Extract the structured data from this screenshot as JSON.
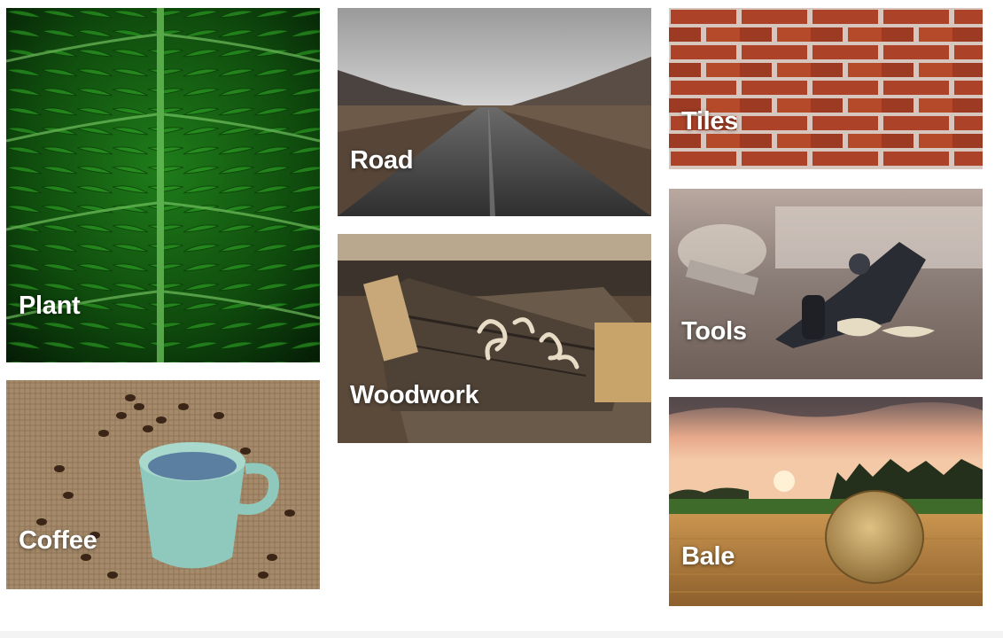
{
  "gallery": {
    "items": [
      {
        "id": "plant",
        "caption": "Plant"
      },
      {
        "id": "road",
        "caption": "Road"
      },
      {
        "id": "tiles",
        "caption": "Tiles"
      },
      {
        "id": "woodwork",
        "caption": "Woodwork"
      },
      {
        "id": "tools",
        "caption": "Tools"
      },
      {
        "id": "coffee",
        "caption": "Coffee"
      },
      {
        "id": "bale",
        "caption": "Bale"
      }
    ]
  }
}
